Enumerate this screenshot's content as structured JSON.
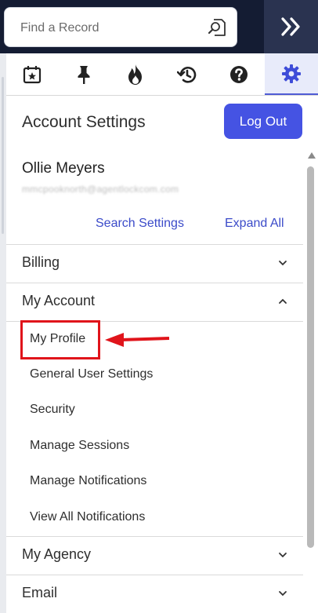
{
  "search": {
    "placeholder": "Find a Record"
  },
  "panel": {
    "title": "Account Settings",
    "logout_label": "Log Out"
  },
  "user": {
    "name": "Ollie Meyers",
    "email": "mmcpooknorth@agentlockcom.com"
  },
  "links": {
    "search_settings": "Search Settings",
    "expand_all": "Expand All"
  },
  "sections": {
    "billing": "Billing",
    "my_account": "My Account",
    "my_agency": "My Agency",
    "email": "Email"
  },
  "my_account_items": [
    "My Profile",
    "General User Settings",
    "Security",
    "Manage Sessions",
    "Manage Notifications",
    "View All Notifications"
  ],
  "toolbar_icons": [
    "calendar-star-icon",
    "pin-icon",
    "flame-icon",
    "history-icon",
    "help-icon",
    "gear-icon"
  ],
  "colors": {
    "accent": "#4553e3",
    "link": "#3b4bc9",
    "topbar": "#141c33",
    "annotation": "#e0141b"
  }
}
